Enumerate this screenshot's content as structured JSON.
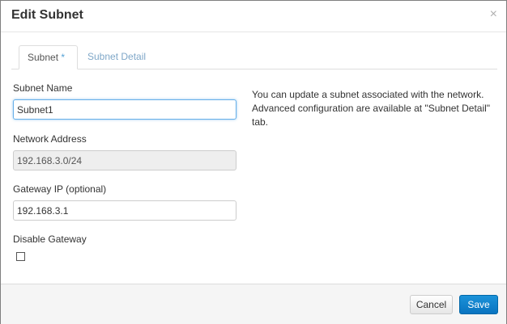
{
  "dialog": {
    "title": "Edit Subnet",
    "close_glyph": "×"
  },
  "tabs": [
    {
      "label": "Subnet",
      "required_mark": "*",
      "active": true
    },
    {
      "label": "Subnet Detail",
      "active": false
    }
  ],
  "form": {
    "subnet_name": {
      "label": "Subnet Name",
      "value": "Subnet1"
    },
    "network_address": {
      "label": "Network Address",
      "value": "192.168.3.0/24"
    },
    "gateway_ip": {
      "label": "Gateway IP (optional)",
      "value": "192.168.3.1"
    },
    "disable_gateway": {
      "label": "Disable Gateway",
      "checked": false
    }
  },
  "help_text": "You can update a subnet associated with the network. Advanced configuration are available at \"Subnet Detail\" tab.",
  "footer": {
    "cancel_label": "Cancel",
    "save_label": "Save"
  },
  "colors": {
    "primary": "#0a74c0",
    "tab_inactive": "#7fa7c8",
    "focus_border": "#66afe9"
  },
  "icons": {
    "close": "close-icon",
    "checkbox": "checkbox-icon"
  }
}
